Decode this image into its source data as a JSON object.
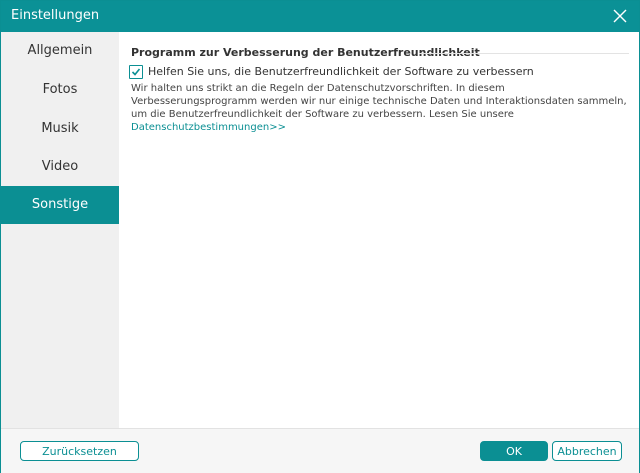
{
  "window": {
    "title": "Einstellungen"
  },
  "sidebar": {
    "items": [
      {
        "label": "Allgemein"
      },
      {
        "label": "Fotos"
      },
      {
        "label": "Musik"
      },
      {
        "label": "Video"
      },
      {
        "label": "Sonstige"
      }
    ],
    "active_item": "Sonstige"
  },
  "main": {
    "section_title": "Programm zur Verbesserung der Benutzerfreundlichkeit",
    "checkbox": {
      "label": "Helfen Sie uns, die Benutzerfreundlichkeit der Software zu verbessern",
      "checked": true
    },
    "description": "Wir halten uns strikt an die Regeln der Datenschutzvorschriften. In diesem Verbesserungsprogramm werden wir nur einige technische Daten und Interaktionsdaten sammeln, um die Benutzerfreundlichkeit der Software zu verbessern. Lesen Sie unsere ",
    "link_text": "Datenschutzbestimmungen>>"
  },
  "footer": {
    "reset_label": "Zurücksetzen",
    "ok_label": "OK",
    "cancel_label": "Abbrechen"
  },
  "colors": {
    "accent": "#0b8f93",
    "title_bar": "#0b9196",
    "sidebar_bg": "#f0f0f0",
    "content_bg": "#ffffff"
  },
  "icons": {
    "close": "close-icon",
    "check": "checkmark-icon"
  }
}
